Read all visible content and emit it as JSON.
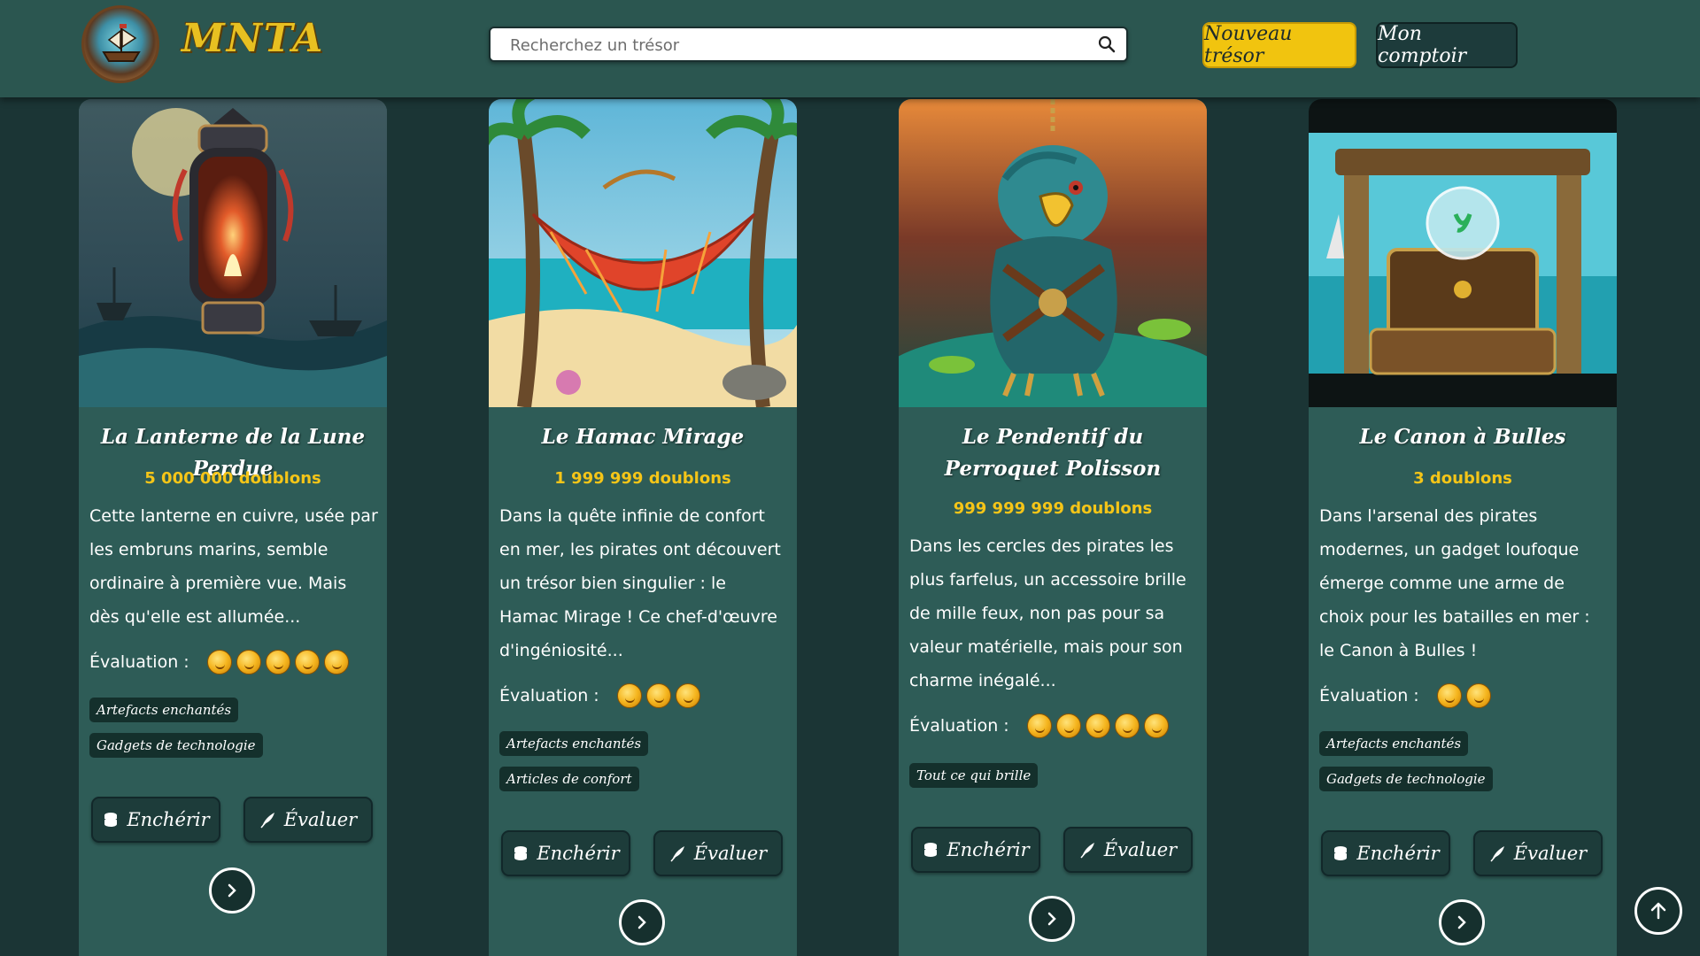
{
  "header": {
    "brand": "MNTA",
    "search": {
      "placeholder": "Recherchez un trésor",
      "value": ""
    },
    "new_treasure_label": "Nouveau trésor",
    "my_counter_label": "Mon comptoir"
  },
  "cards": [
    {
      "title": "La Lanterne de la Lune Perdue",
      "price": "5 000 000 doublons",
      "description": "Cette lanterne en cuivre, usée par les embruns marins, semble ordinaire à première vue. Mais dès qu'elle est allumée...",
      "rating_label": "Évaluation :",
      "rating": 5,
      "tags": [
        "Artefacts enchantés",
        "Gadgets de technologie"
      ],
      "bid_label": "Enchérir",
      "rate_label": "Évaluer",
      "image": "lantern-image"
    },
    {
      "title": "Le Hamac Mirage",
      "price": "1 999 999 doublons",
      "description": "Dans la quête infinie de confort en mer, les pirates ont découvert un trésor bien singulier : le Hamac Mirage ! Ce chef-d'œuvre d'ingéniosité...",
      "rating_label": "Évaluation :",
      "rating": 3,
      "tags": [
        "Artefacts enchantés",
        "Articles de confort"
      ],
      "bid_label": "Enchérir",
      "rate_label": "Évaluer",
      "image": "hammock-image"
    },
    {
      "title": "Le Pendentif du Perroquet Polisson",
      "price": "999 999 999 doublons",
      "description": "Dans les cercles des pirates les plus farfelus, un accessoire brille de mille feux, non pas pour sa valeur matérielle, mais pour son charme inégalé...",
      "rating_label": "Évaluation :",
      "rating": 5,
      "tags": [
        "Tout ce qui brille"
      ],
      "bid_label": "Enchérir",
      "rate_label": "Évaluer",
      "image": "parrot-pendant-image"
    },
    {
      "title": "Le Canon à Bulles",
      "price": "3 doublons",
      "description": "Dans l'arsenal des pirates modernes, un gadget loufoque émerge comme une arme de choix pour les batailles en mer : le Canon à Bulles !",
      "rating_label": "Évaluation :",
      "rating": 2,
      "tags": [
        "Artefacts enchantés",
        "Gadgets de technologie"
      ],
      "bid_label": "Enchérir",
      "rate_label": "Évaluer",
      "image": "bubble-cannon-image"
    }
  ],
  "colors": {
    "background": "#1b3535",
    "header": "#2b5650",
    "card": "#2e5c57",
    "accent_yellow": "#f1c40f",
    "price_yellow": "#f5c518",
    "tag_bg": "#14302c"
  }
}
